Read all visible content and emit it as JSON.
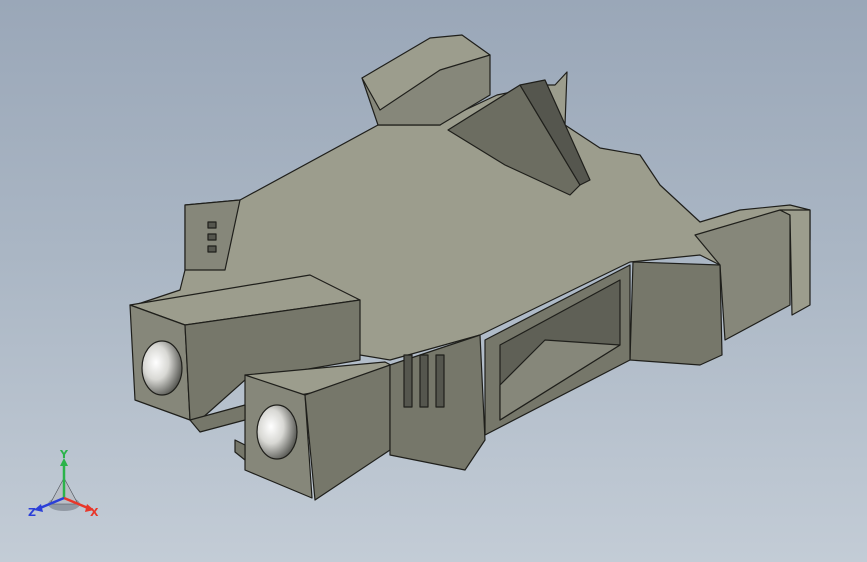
{
  "viewport": {
    "background_top": "#9aa7b8",
    "background_bottom": "#c3ccd6"
  },
  "model": {
    "color_top": "#9c9d8d",
    "color_front": "#76776a",
    "color_side": "#86877a",
    "color_dark": "#55564e",
    "color_edge": "#1f1f1b",
    "hole_light": "#f2f2ef",
    "hole_dark": "#4a4b46"
  },
  "triad": {
    "x_label": "X",
    "y_label": "Y",
    "z_label": "Z",
    "x_color": "#e8372a",
    "y_color": "#2bb34a",
    "z_color": "#2b3fd8"
  }
}
